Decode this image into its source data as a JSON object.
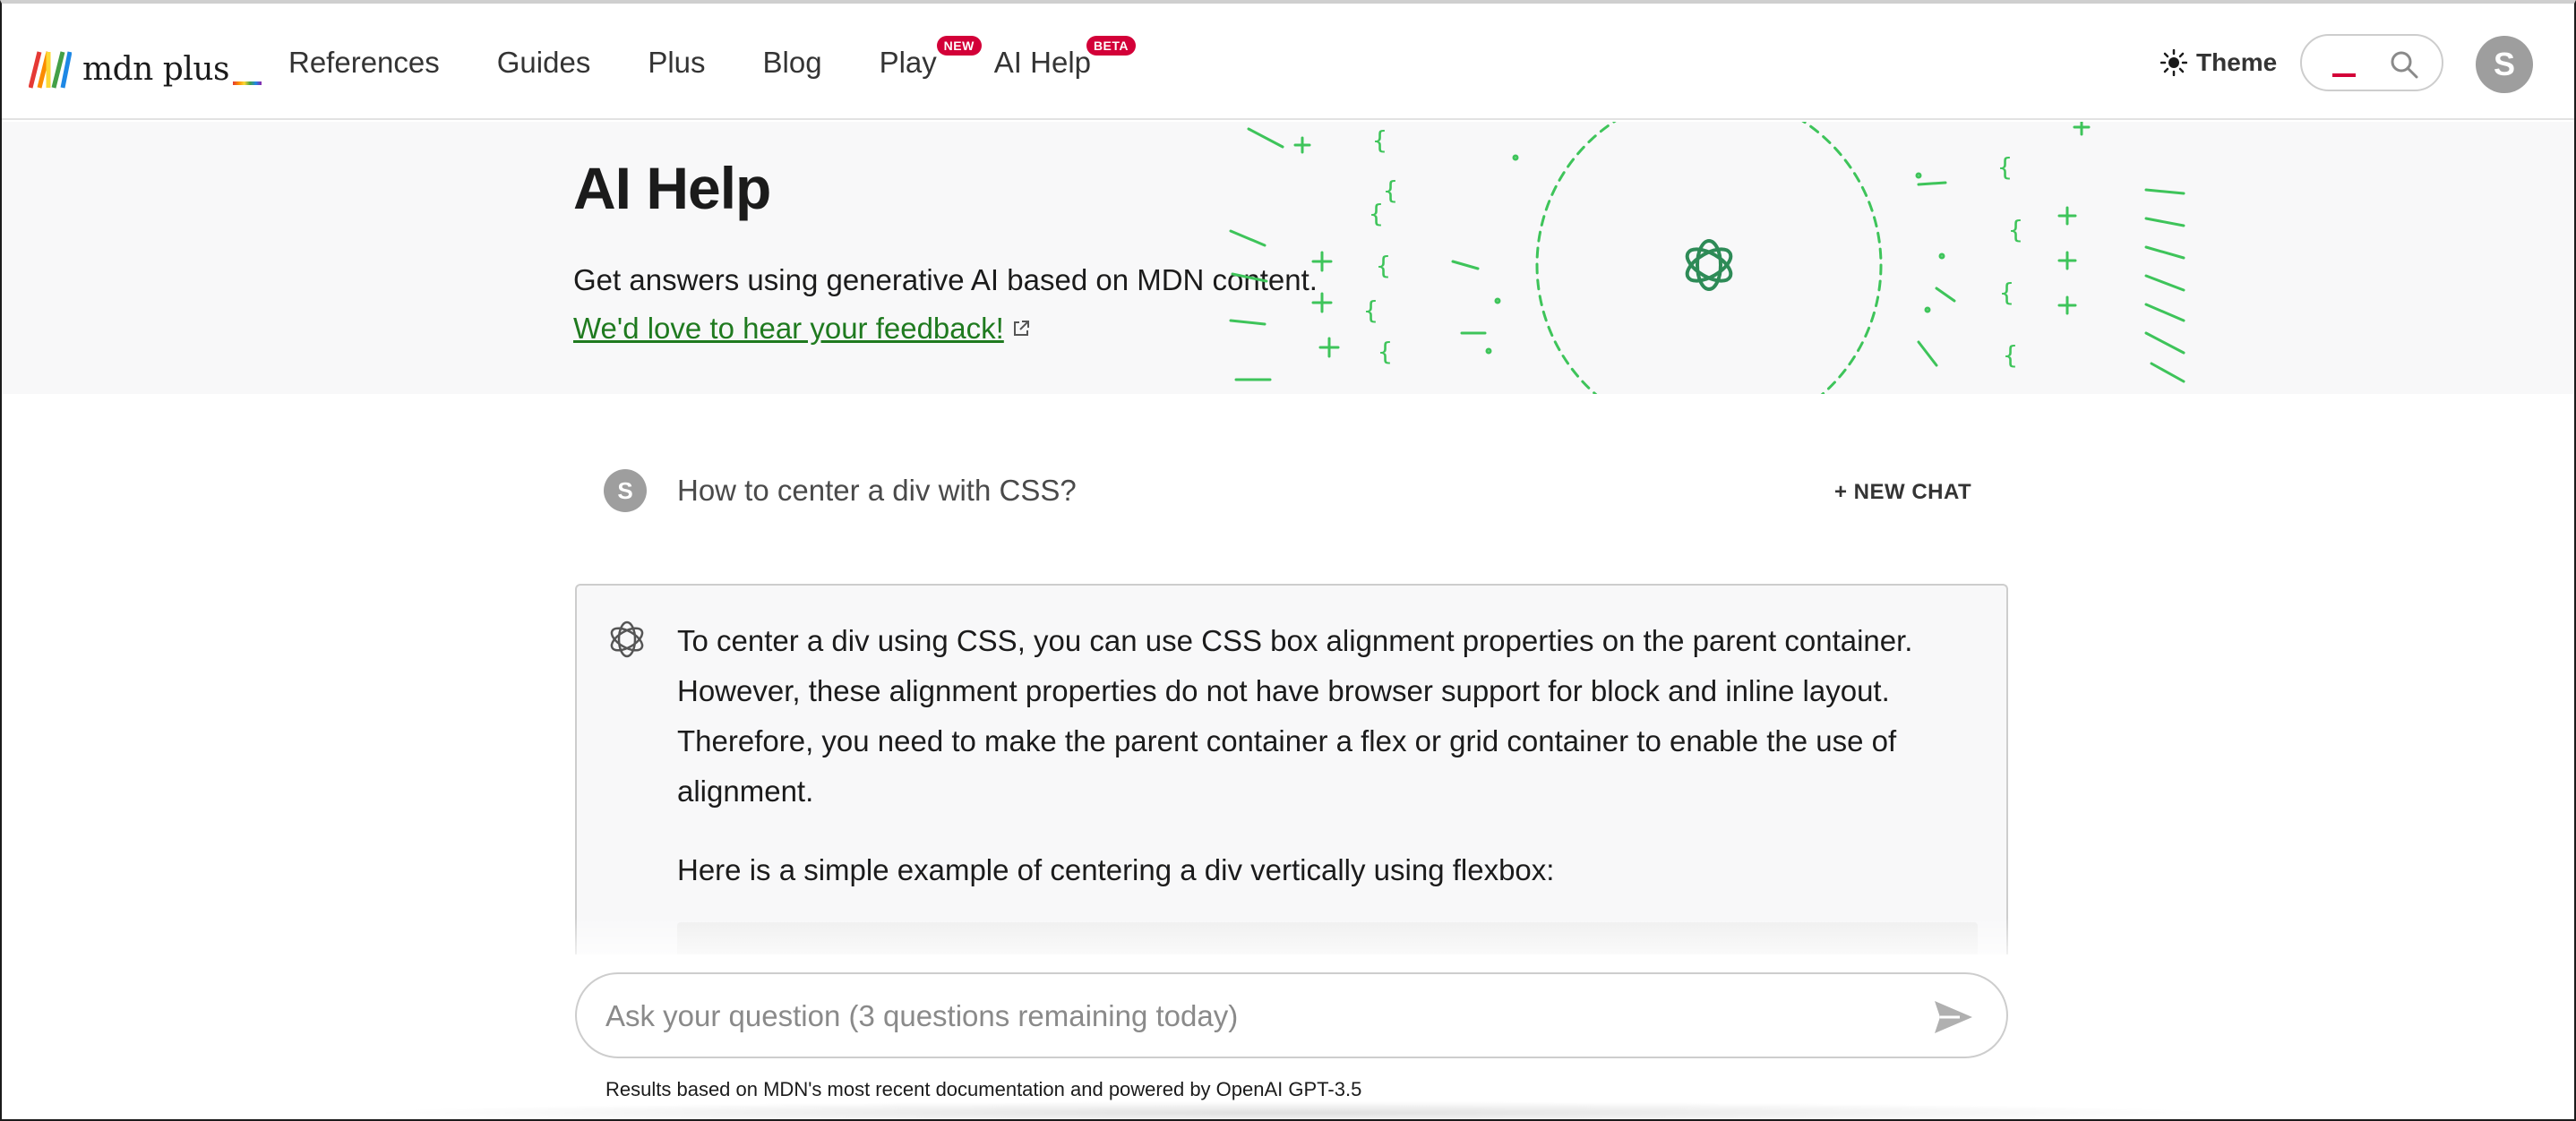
{
  "header": {
    "logo_text": "mdn plus",
    "nav": [
      {
        "label": "References",
        "badge": ""
      },
      {
        "label": "Guides",
        "badge": ""
      },
      {
        "label": "Plus",
        "badge": ""
      },
      {
        "label": "Blog",
        "badge": ""
      },
      {
        "label": "Play",
        "badge": "NEW"
      },
      {
        "label": "AI Help",
        "badge": "BETA"
      }
    ],
    "theme_label": "Theme",
    "avatar_initial": "S"
  },
  "hero": {
    "title": "AI Help",
    "subtitle": "Get answers using generative AI based on MDN content.",
    "feedback_link": "We'd love to hear your feedback!"
  },
  "chat": {
    "user_initial": "S",
    "question": "How to center a div with CSS?",
    "new_chat_label": "+ NEW CHAT",
    "answer_paragraphs": [
      "To center a div using CSS, you can use CSS box alignment properties on the parent container. However, these alignment properties do not have browser support for block and inline layout. Therefore, you need to make the parent container a flex or grid container to enable the use of alignment.",
      "Here is a simple example of centering a div vertically using flexbox:"
    ]
  },
  "composer": {
    "placeholder": "Ask your question (3 questions remaining today)"
  },
  "footer": {
    "note": "Results based on MDN's most recent documentation and powered by OpenAI GPT-3.5"
  },
  "colors": {
    "accent_green": "#1f7a1f",
    "badge_red": "#d30038",
    "pattern_green": "#3ec45a"
  },
  "icons": [
    "mdn-logo-icon",
    "sun-icon",
    "search-icon",
    "external-link-icon",
    "openai-icon",
    "send-icon"
  ]
}
